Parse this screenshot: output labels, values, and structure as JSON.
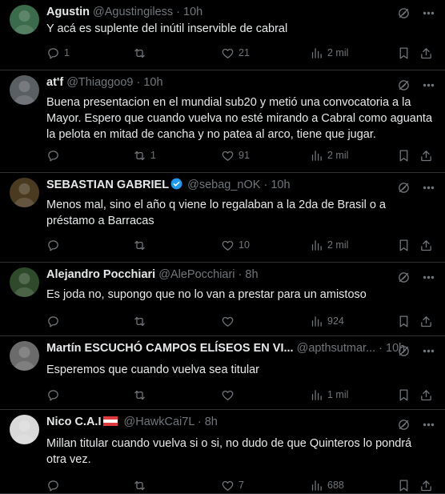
{
  "tweets": [
    {
      "name": "Agustin",
      "handle": "@Agustingiless",
      "time": "10h",
      "text": "Y acá es suplente del inútil inservible de cabral",
      "replies": "1",
      "retweets": "",
      "likes": "21",
      "views": "2 mil",
      "verified": false,
      "flag": false,
      "avatar_color": "#3a6b4a"
    },
    {
      "name": "at'f",
      "handle": "@Thiaggoo9",
      "time": "10h",
      "text": "Buena presentacion en el mundial sub20 y metió una convocatoria a la Mayor. Espero que cuando vuelva no esté mirando a Cabral como aguanta la pelota en mitad de cancha y no patea al arco, tiene que jugar.",
      "replies": "",
      "retweets": "1",
      "likes": "91",
      "views": "2 mil",
      "verified": false,
      "flag": false,
      "avatar_color": "#5a5f63"
    },
    {
      "name": "SEBASTIAN GABRIEL",
      "handle": "@sebag_nOK",
      "time": "10h",
      "text": "Menos mal, sino el año q viene lo regalaban a la 2da de Brasil o a préstamo a Barracas",
      "replies": "",
      "retweets": "",
      "likes": "10",
      "views": "2 mil",
      "verified": true,
      "flag": false,
      "avatar_color": "#4a3a1f"
    },
    {
      "name": "Alejandro Pocchiari",
      "handle": "@AlePocchiari",
      "time": "8h",
      "text": "Es joda no, supongo que no lo van a prestar para un amistoso",
      "replies": "",
      "retweets": "",
      "likes": "",
      "views": "924",
      "verified": false,
      "flag": false,
      "avatar_color": "#2f4a2a"
    },
    {
      "name": "Martín ESCUCHÓ CAMPOS ELÍSEOS EN VI...",
      "handle": "@apthsutmar...",
      "time": "10h",
      "text": "Esperemos que cuando vuelva sea titular",
      "replies": "",
      "retweets": "",
      "likes": "",
      "views": "1 mil",
      "verified": false,
      "flag": false,
      "avatar_color": "#6b6b6b"
    },
    {
      "name": "Nico C.A.I",
      "handle": "@HawkCai7L",
      "time": "8h",
      "text": "Millan titular cuando vuelva si o si, no dudo de que Quinteros lo pondrá otra vez.",
      "replies": "",
      "retweets": "",
      "likes": "7",
      "views": "688",
      "verified": false,
      "flag": true,
      "avatar_color": "#d9d9d9"
    }
  ],
  "colors": {
    "background": "#000000",
    "text": "#e7e9ea",
    "muted": "#71767b",
    "verified": "#1d9bf0",
    "divider": "#2f3336"
  },
  "icons": [
    "grok-icon",
    "more-icon",
    "reply-icon",
    "retweet-icon",
    "like-icon",
    "views-icon",
    "bookmark-icon",
    "share-icon"
  ]
}
